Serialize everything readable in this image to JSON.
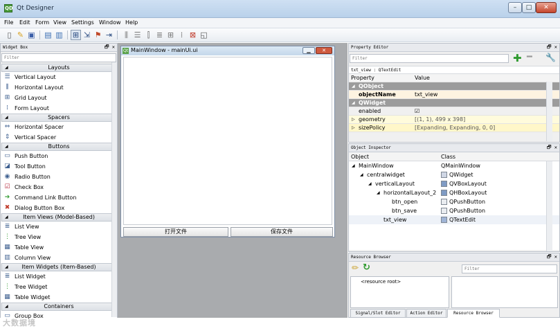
{
  "app": {
    "title": "Qt Designer",
    "icon": "QD"
  },
  "window_controls": {
    "minimize": "–",
    "maximize": "□",
    "close": "✕"
  },
  "menubar": {
    "items": [
      "File",
      "Edit",
      "Form",
      "View",
      "Settings",
      "Window",
      "Help"
    ]
  },
  "toolbar": {
    "icons": [
      "new-form-icon",
      "open-form-icon",
      "save-form-icon",
      "send-to-back-icon",
      "bring-to-front-icon",
      "edit-widgets-icon",
      "edit-signals-slots-icon",
      "edit-buddies-icon",
      "edit-tab-order-icon",
      "lay-out-horizontally-icon",
      "lay-out-vertically-icon",
      "lay-out-horizontal-splitter-icon",
      "lay-out-vertical-splitter-icon",
      "lay-out-grid-icon",
      "lay-out-form-icon",
      "break-layout-icon",
      "adjust-size-icon"
    ]
  },
  "widget_box": {
    "title": "Widget Box",
    "filter_placeholder": "Filter",
    "categories": [
      {
        "name": "Layouts",
        "items": [
          {
            "label": "Vertical Layout",
            "icon": "vertical-layout-icon"
          },
          {
            "label": "Horizontal Layout",
            "icon": "horizontal-layout-icon"
          },
          {
            "label": "Grid Layout",
            "icon": "grid-layout-icon"
          },
          {
            "label": "Form Layout",
            "icon": "form-layout-icon"
          }
        ]
      },
      {
        "name": "Spacers",
        "items": [
          {
            "label": "Horizontal Spacer",
            "icon": "horizontal-spacer-icon"
          },
          {
            "label": "Vertical Spacer",
            "icon": "vertical-spacer-icon"
          }
        ]
      },
      {
        "name": "Buttons",
        "items": [
          {
            "label": "Push Button",
            "icon": "push-button-icon"
          },
          {
            "label": "Tool Button",
            "icon": "tool-button-icon"
          },
          {
            "label": "Radio Button",
            "icon": "radio-button-icon"
          },
          {
            "label": "Check Box",
            "icon": "check-box-icon"
          },
          {
            "label": "Command Link Button",
            "icon": "command-link-icon"
          },
          {
            "label": "Dialog Button Box",
            "icon": "dialog-button-box-icon"
          }
        ]
      },
      {
        "name": "Item Views (Model-Based)",
        "items": [
          {
            "label": "List View",
            "icon": "list-view-icon"
          },
          {
            "label": "Tree View",
            "icon": "tree-view-icon"
          },
          {
            "label": "Table View",
            "icon": "table-view-icon"
          },
          {
            "label": "Column View",
            "icon": "column-view-icon"
          }
        ]
      },
      {
        "name": "Item Widgets (Item-Based)",
        "items": [
          {
            "label": "List Widget",
            "icon": "list-widget-icon"
          },
          {
            "label": "Tree Widget",
            "icon": "tree-widget-icon"
          },
          {
            "label": "Table Widget",
            "icon": "table-widget-icon"
          }
        ]
      },
      {
        "name": "Containers",
        "items": [
          {
            "label": "Group Box",
            "icon": "group-box-icon"
          }
        ]
      }
    ]
  },
  "form": {
    "title": "MainWindow - mainUi.ui",
    "buttons": [
      "打开文件",
      "保存文件"
    ]
  },
  "property_editor": {
    "title": "Property Editor",
    "filter_placeholder": "Filter",
    "object_label": "txt_view : QTextEdit",
    "headers": [
      "Property",
      "Value"
    ],
    "rows": [
      {
        "kind": "group",
        "name": "QObject",
        "value": ""
      },
      {
        "kind": "prop-bold",
        "name": "objectName",
        "value": "txt_view"
      },
      {
        "kind": "group",
        "name": "QWidget",
        "value": ""
      },
      {
        "kind": "prop",
        "name": "enabled",
        "value": "☑"
      },
      {
        "kind": "prop-yel",
        "name": "geometry",
        "value": "[(1, 1), 499 x 398]"
      },
      {
        "kind": "prop-yel2",
        "name": "sizePolicy",
        "value": "[Expanding, Expanding, 0, 0]"
      }
    ]
  },
  "object_inspector": {
    "title": "Object Inspector",
    "headers": [
      "Object",
      "Class"
    ],
    "rows": [
      {
        "depth": 0,
        "expander": "◢",
        "name": "MainWindow",
        "class": "QMainWindow",
        "icon": ""
      },
      {
        "depth": 1,
        "expander": "◢",
        "name": "centralwidget",
        "class": "QWidget",
        "icon": "widget-icon"
      },
      {
        "depth": 2,
        "expander": "◢",
        "name": "verticalLayout",
        "class": "QVBoxLayout",
        "icon": "vbox-layout-icon"
      },
      {
        "depth": 3,
        "expander": "◢",
        "name": "horizontalLayout_2",
        "class": "QHBoxLayout",
        "icon": "hbox-layout-icon"
      },
      {
        "depth": 4,
        "expander": "",
        "name": "btn_open",
        "class": "QPushButton",
        "icon": "push-button-icon"
      },
      {
        "depth": 4,
        "expander": "",
        "name": "btn_save",
        "class": "QPushButton",
        "icon": "push-button-icon"
      },
      {
        "depth": 3,
        "expander": "",
        "name": "txt_view",
        "class": "QTextEdit",
        "icon": "text-edit-icon",
        "selected": true
      }
    ]
  },
  "resource_browser": {
    "title": "Resource Browser",
    "filter_placeholder": "Filter",
    "root_item": "<resource root>",
    "tabs": [
      "Signal/Slot Editor",
      "Action Editor",
      "Resource Browser"
    ]
  },
  "dock_controls": "🗗 ✕",
  "watermark": "大数据境"
}
